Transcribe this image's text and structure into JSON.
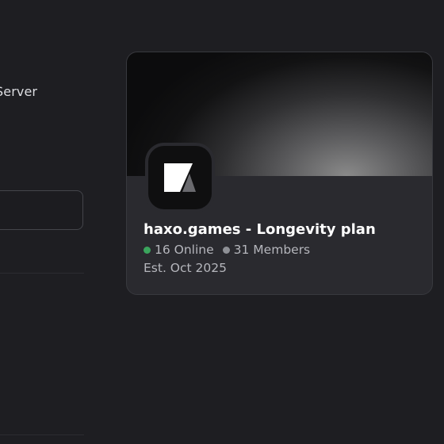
{
  "left_panel": {
    "label": "Server",
    "input_value": ""
  },
  "server_card": {
    "name": "haxo.games - Longevity plan",
    "online_count": "16 Online",
    "member_count": "31 Members",
    "established": "Est. Oct 2025",
    "icon": "server-logo-icon",
    "online_color": "#3ba55d",
    "members_color": "#8e9096"
  }
}
